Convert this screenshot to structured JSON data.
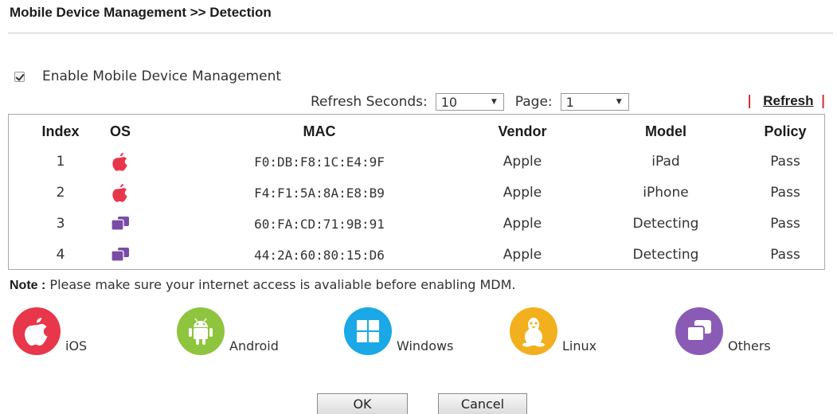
{
  "page": {
    "title": "Mobile Device Management >> Detection"
  },
  "enable": {
    "label": "Enable Mobile Device Management",
    "checked": true
  },
  "controls": {
    "refresh_seconds_label": "Refresh Seconds:",
    "refresh_seconds_value": "10",
    "page_label": "Page:",
    "page_value": "1",
    "refresh_link": "Refresh",
    "separator": "|"
  },
  "table": {
    "headers": {
      "index": "Index",
      "os": "OS",
      "mac": "MAC",
      "vendor": "Vendor",
      "model": "Model",
      "policy": "Policy"
    },
    "rows": [
      {
        "index": "1",
        "os_icon": "apple-icon",
        "mac": "F0:DB:F8:1C:E4:9F",
        "vendor": "Apple",
        "model": "iPad",
        "policy": "Pass"
      },
      {
        "index": "2",
        "os_icon": "apple-icon",
        "mac": "F4:F1:5A:8A:E8:B9",
        "vendor": "Apple",
        "model": "iPhone",
        "policy": "Pass"
      },
      {
        "index": "3",
        "os_icon": "others-icon",
        "mac": "60:FA:CD:71:9B:91",
        "vendor": "Apple",
        "model": "Detecting",
        "policy": "Pass"
      },
      {
        "index": "4",
        "os_icon": "others-icon",
        "mac": "44:2A:60:80:15:D6",
        "vendor": "Apple",
        "model": "Detecting",
        "policy": "Pass"
      }
    ]
  },
  "note": {
    "prefix": "Note :",
    "text": "Please make sure your internet access is avaliable before enabling MDM."
  },
  "legend": [
    {
      "label": "iOS",
      "icon": "apple-icon",
      "color": "#e8374a"
    },
    {
      "label": "Android",
      "icon": "android-icon",
      "color": "#8fc43f"
    },
    {
      "label": "Windows",
      "icon": "windows-icon",
      "color": "#1aa8e6"
    },
    {
      "label": "Linux",
      "icon": "linux-icon",
      "color": "#f2b01e"
    },
    {
      "label": "Others",
      "icon": "others-icon",
      "color": "#8a5bb5"
    }
  ],
  "buttons": {
    "ok": "OK",
    "cancel": "Cancel"
  },
  "colors": {
    "apple_red": "#e8374a",
    "others_purple": "#7a4ba6",
    "refresh_bar": "#d61f26"
  }
}
